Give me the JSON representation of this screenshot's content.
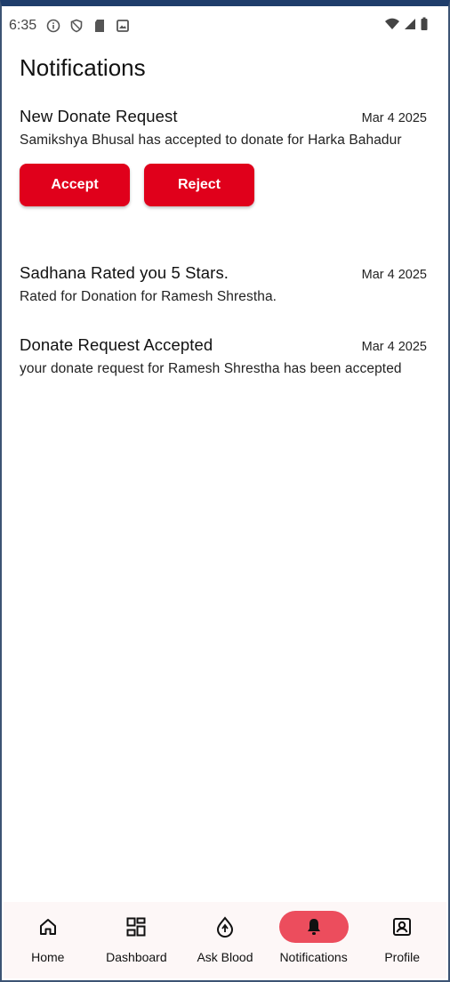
{
  "status_bar": {
    "time": "6:35",
    "left_icons": [
      "info-icon",
      "shield-icon",
      "sd-card-icon",
      "image-icon"
    ],
    "right_icons": [
      "wifi-icon",
      "signal-icon",
      "battery-icon"
    ]
  },
  "page": {
    "title": "Notifications"
  },
  "notifications": [
    {
      "title": "New Donate Request",
      "date": "Mar 4 2025",
      "body": "Samikshya Bhusal has accepted to donate for Harka Bahadur",
      "actions": {
        "accept": "Accept",
        "reject": "Reject"
      }
    },
    {
      "title": "Sadhana Rated you 5 Stars.",
      "date": "Mar 4 2025",
      "body": "Rated for Donation for Ramesh Shrestha."
    },
    {
      "title": "Donate Request Accepted",
      "date": "Mar 4 2025",
      "body": "your donate request for Ramesh Shrestha has been accepted"
    }
  ],
  "bottom_nav": {
    "items": [
      {
        "label": "Home",
        "icon": "home-icon"
      },
      {
        "label": "Dashboard",
        "icon": "dashboard-icon"
      },
      {
        "label": "Ask Blood",
        "icon": "blood-drop-icon"
      },
      {
        "label": "Notifications",
        "icon": "bell-icon",
        "active": true
      },
      {
        "label": "Profile",
        "icon": "profile-icon"
      }
    ]
  },
  "colors": {
    "accent": "#e0001b",
    "active_pill": "#ec4d5d",
    "nav_background": "#fdf7f7",
    "frame_border": "#3c5374"
  }
}
